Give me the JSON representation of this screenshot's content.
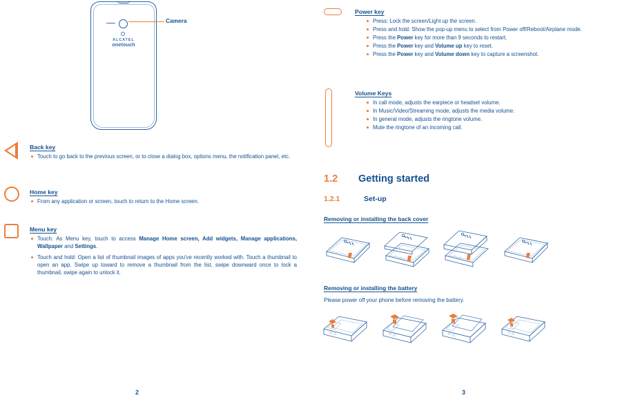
{
  "document": {
    "type": "user-manual-spread",
    "colors": {
      "blue": "#14508e",
      "orange": "#ed7d3a",
      "line_blue": "#2a62a5",
      "light_blue": "#9fbddd"
    }
  },
  "left_page": {
    "page_number": "2",
    "illustration": {
      "callout_label": "Camera",
      "brand_line1": "ALCATEL",
      "brand_line2": "onetouch"
    },
    "keys": [
      {
        "icon": "back-triangle-icon",
        "title": "Back key",
        "bullets": [
          "Touch to go back to the previous screen, or to close a dialog box, options menu, the notification panel, etc."
        ]
      },
      {
        "icon": "home-circle-icon",
        "title": "Home key",
        "bullets": [
          "From any application or screen, touch to return to the Home screen."
        ]
      },
      {
        "icon": "menu-square-icon",
        "title": "Menu key",
        "bullets": [
          "Touch: As Menu key, touch to access Manage Home screen, Add widgets, Manage applications, Wallpaper and Settings.",
          "Touch and hold: Open a list of thumbnail images of apps you've recently worked with. Touch a thumbnail to open an app. Swipe up toward to remove a thumbnail from the list, swipe downward once to lock a thumbnail, swipe again to unlock it."
        ]
      }
    ]
  },
  "right_page": {
    "page_number": "3",
    "keys": [
      {
        "icon": "power-pill-icon",
        "title": "Power key",
        "bullets": [
          "Press: Lock the screen/Light up the screen.",
          "Press and hold: Show the pop-up menu to select from Power off/Reboot/Airplane mode.",
          "Press the Power key for more than 9 seconds to restart.",
          "Press the Power key and Volume up key to reset.",
          "Press the Power key and Volume down key to capture a screenshot."
        ]
      },
      {
        "icon": "volume-pill-icon",
        "title": "Volume Keys",
        "bullets": [
          "In call mode, adjusts the earpiece or headset volume.",
          "In Music/Video/Streaming mode, adjusts the media volume.",
          "In general mode, adjusts the ringtone volume.",
          "Mute the ringtone of an incoming call."
        ]
      }
    ],
    "section": {
      "number": "1.2",
      "title": "Getting started",
      "subsection_number": "1.2.1",
      "subsection_title": "Set-up",
      "back_cover_heading": "Removing or installing the back cover",
      "battery_heading": "Removing or installing the battery",
      "battery_note": "Please power off your phone before removing the battery."
    }
  }
}
